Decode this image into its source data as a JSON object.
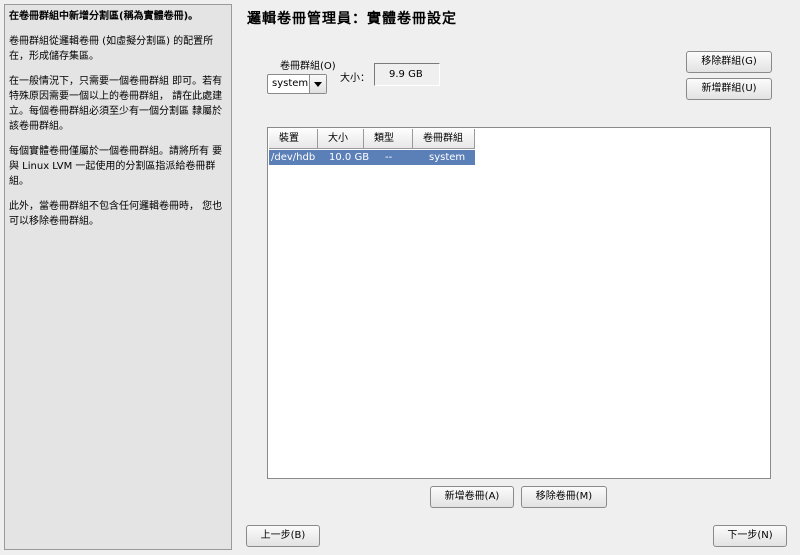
{
  "help": {
    "title": "在卷冊群組中新增分割區(稱為實體卷冊)。",
    "paragraphs": [
      "卷冊群組從邏輯卷冊 (如虛擬分割區) 的配置所在，形成儲存集區。",
      "在一般情況下，只需要一個卷冊群組 即可。若有特殊原因需要一個以上的卷冊群組， 請在此處建立。每個卷冊群組必須至少有一個分割區 隸屬於該卷冊群組。",
      "每個實體卷冊僅屬於一個卷冊群組。請將所有 要與 Linux LVM 一起使用的分割區指派給卷冊群組。",
      "此外，當卷冊群組不包含任何邏輯卷冊時， 您也可以移除卷冊群組。"
    ]
  },
  "title": "邏輯卷冊管理員：實體卷冊設定",
  "volume_group": {
    "label": "卷冊群組(O)",
    "selected": "system"
  },
  "size": {
    "label": "大小：",
    "value": "9.9 GB"
  },
  "buttons": {
    "remove_group": "移除群組(G)",
    "add_group": "新增群組(U)",
    "add_volume": "新增卷冊(A)",
    "remove_volume": "移除卷冊(M)",
    "back": "上一步(B)",
    "next": "下一步(N)"
  },
  "table": {
    "columns": [
      "裝置",
      "大小",
      "類型",
      "卷冊群組"
    ],
    "rows": [
      {
        "device": "/dev/hdb",
        "size": "10.0 GB",
        "type": "--",
        "group": "system"
      }
    ]
  }
}
